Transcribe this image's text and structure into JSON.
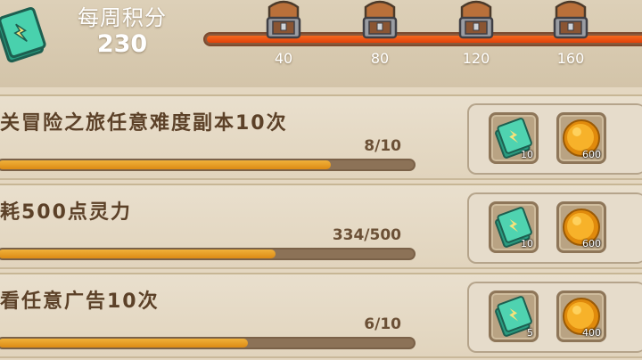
{
  "header": {
    "title": "每周积分",
    "points": "230",
    "progress_fraction": 1.0,
    "milestones": [
      {
        "label": "40",
        "icon": "chest-icon"
      },
      {
        "label": "80",
        "icon": "chest-icon"
      },
      {
        "label": "120",
        "icon": "chest-icon"
      },
      {
        "label": "160",
        "icon": "chest-icon"
      }
    ]
  },
  "tasks": [
    {
      "name": "关冒险之旅任意难度副本10次",
      "progress_text": "8/10",
      "progress_fraction": 0.8,
      "rewards": [
        {
          "icon": "ticket-icon",
          "count": "10"
        },
        {
          "icon": "gold-coin-icon",
          "count": "600"
        }
      ]
    },
    {
      "name": "耗500点灵力",
      "progress_text": "334/500",
      "progress_fraction": 0.668,
      "rewards": [
        {
          "icon": "ticket-icon",
          "count": "10"
        },
        {
          "icon": "gold-coin-icon",
          "count": "600"
        }
      ]
    },
    {
      "name": "看任意广告10次",
      "progress_text": "6/10",
      "progress_fraction": 0.6,
      "rewards": [
        {
          "icon": "ticket-icon",
          "count": "5"
        },
        {
          "icon": "gold-coin-icon",
          "count": "400"
        }
      ]
    }
  ],
  "colors": {
    "background": "#e4d7c1",
    "score_bar": "#e2420b",
    "task_bar": "#dc8a14",
    "ticket": "#3fc7a4",
    "coin": "#f5a512"
  }
}
